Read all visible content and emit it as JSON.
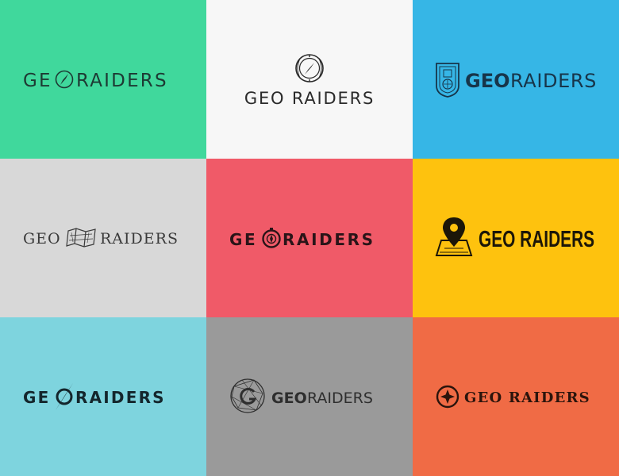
{
  "tiles": [
    {
      "id": "green",
      "color": "#40d89c",
      "text": "GEORAIDERS",
      "part1": "GE",
      "part2": "RAIDERS"
    },
    {
      "id": "white",
      "color": "#f7f7f7",
      "text": "GEO RAIDERS"
    },
    {
      "id": "blue",
      "color": "#36b6e6",
      "part1": "GEO",
      "part2": "RAIDERS"
    },
    {
      "id": "light-gray",
      "color": "#d8d8d8",
      "part1": "GEO",
      "part2": "RAIDERS"
    },
    {
      "id": "red",
      "color": "#f05a68",
      "part1": "GE",
      "part2": "RAIDERS"
    },
    {
      "id": "yellow",
      "color": "#fec20e",
      "text": "GEO RAIDERS"
    },
    {
      "id": "light-blue",
      "color": "#7ed4de",
      "part1": "GE",
      "part2": "RAIDERS"
    },
    {
      "id": "gray",
      "color": "#9a9a9a",
      "part1": "GEO",
      "part2": "RAIDERS"
    },
    {
      "id": "orange",
      "color": "#f06b45",
      "text": "GEO RAIDERS"
    }
  ],
  "icons": {
    "green": "compass-o-icon",
    "white": "compass-emblem-icon",
    "blue": "shield-crest-icon",
    "light-gray": "map-icon",
    "red": "compass-o-icon",
    "yellow": "map-pin-icon",
    "light-blue": "needle-o-icon",
    "gray": "globe-g-icon",
    "orange": "compass-star-icon"
  }
}
